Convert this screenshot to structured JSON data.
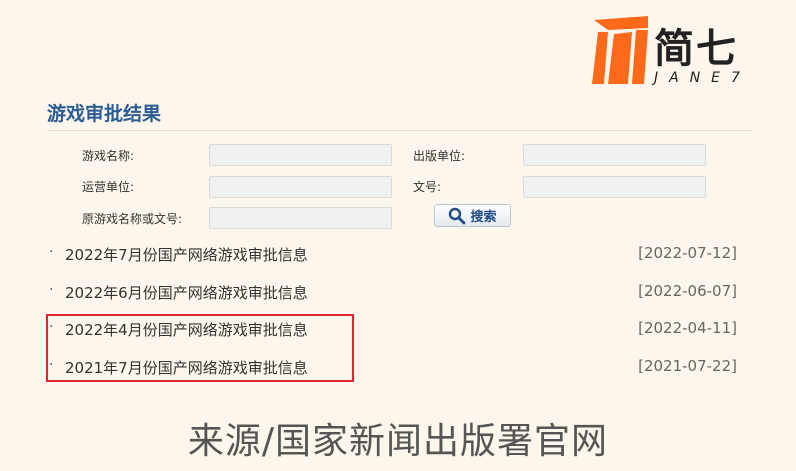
{
  "logo": {
    "cn_text": "简七",
    "en_text": "JANE7",
    "accent": "#ff6a1a"
  },
  "section": {
    "title": "游戏审批结果"
  },
  "form": {
    "game_name_label": "游戏名称:",
    "publisher_label": "出版单位:",
    "operator_label": "运营单位:",
    "doc_no_label": "文号:",
    "original_label": "原游戏名称或文号:",
    "search_label": "搜索",
    "search_icon": "magnifier-icon"
  },
  "news": [
    {
      "title": "2022年7月份国产网络游戏审批信息",
      "date": "[2022-07-12]"
    },
    {
      "title": "2022年6月份国产网络游戏审批信息",
      "date": "[2022-06-07]"
    },
    {
      "title": "2022年4月份国产网络游戏审批信息",
      "date": "[2022-04-11]"
    },
    {
      "title": "2021年7月份国产网络游戏审批信息",
      "date": "[2021-07-22]"
    }
  ],
  "bullet": "·",
  "caption": "来源/国家新闻出版署官网",
  "colors": {
    "title_blue": "#2b5d93",
    "highlight_red": "#e3262c",
    "background": "#fdf6ec"
  }
}
